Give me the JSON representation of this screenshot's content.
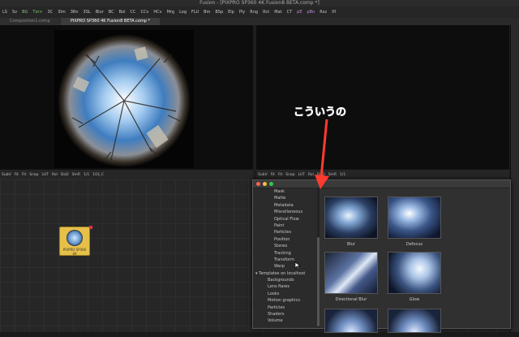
{
  "window_title": "Fusion - [PIXPRO SP360 4K Fusion8 BETA.comp *]",
  "toolbar": [
    "LS",
    "Sv",
    "BG",
    "Txt+",
    "3C",
    "3Im",
    "3Rn",
    "3SL",
    "Blur",
    "BC",
    "Bol",
    "CC",
    "CCv",
    "HCv",
    "Mrg",
    "Log",
    "FLU",
    "Bm",
    "BSp",
    "Elp",
    "Ply",
    "Rng",
    "Rct",
    "Mat",
    "CT",
    "pE",
    "pBn",
    "Rsz",
    "Xf"
  ],
  "tabs": [
    "Composition1.comp",
    "PIXPRO SP360 4K Fusion8 BETA.comp *"
  ],
  "viewer_bar_left": [
    "SubV",
    "Fit",
    "Fit",
    "Snap",
    "LUT",
    "RoI",
    "DoD",
    "SmR",
    "1/1",
    "103_C"
  ],
  "viewer_bar_right": [
    "SubV",
    "Fit",
    "Fit",
    "Snap",
    "LUT",
    "RoI",
    "DoD",
    "SmR",
    "1/1"
  ],
  "node": {
    "label": "PIXPRO SP360 4K"
  },
  "bins": {
    "categories": [
      "Mask",
      "Matte",
      "Metadata",
      "Miscellaneous",
      "Optical Flow",
      "Paint",
      "Particles",
      "Position",
      "Stereo",
      "Tracking",
      "Transform",
      "Warp"
    ],
    "templates_header": "Templates on localhost",
    "templates": [
      "Backgrounds",
      "Lens flares",
      "Looks",
      "Motion graphics",
      "Particles",
      "Shaders",
      "Volume"
    ],
    "thumbnails": [
      {
        "caption": "Blur"
      },
      {
        "caption": "Defocus"
      },
      {
        "caption": "Directional Blur"
      },
      {
        "caption": "Glow"
      }
    ]
  },
  "annotation_text": "こういうの",
  "colors": {
    "annotation": "#ff5a5a",
    "node": "#e7c04a"
  }
}
